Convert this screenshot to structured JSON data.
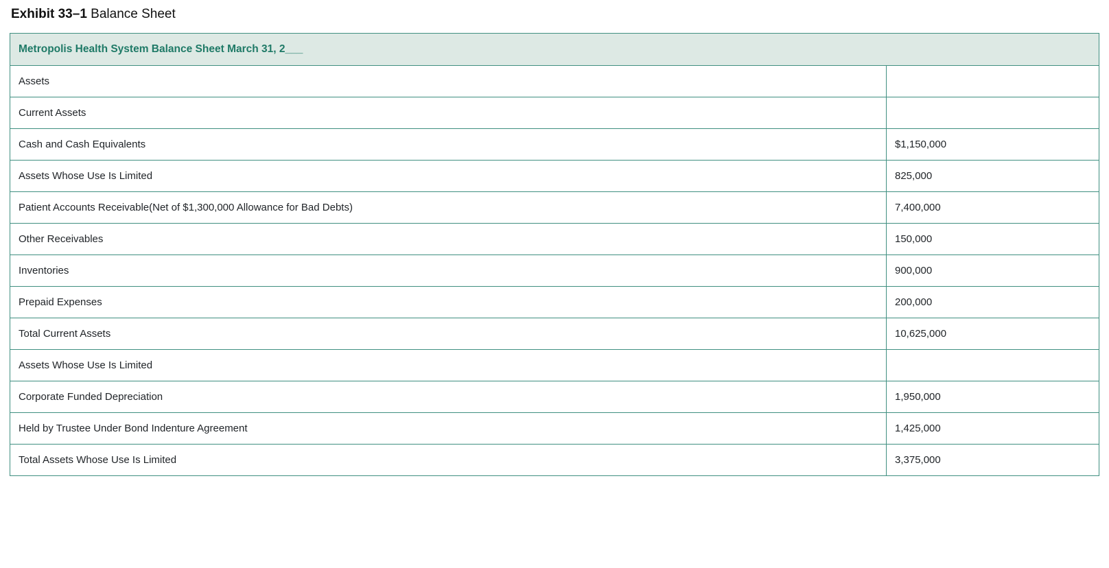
{
  "caption": {
    "bold": "Exhibit 33–1",
    "rest": "Balance Sheet"
  },
  "header": "Metropolis Health System Balance Sheet March 31, 2___",
  "rows": [
    {
      "label": "Assets",
      "value": ""
    },
    {
      "label": "Current Assets",
      "value": ""
    },
    {
      "label": "Cash and Cash Equivalents",
      "value": "$1,150,000"
    },
    {
      "label": "Assets Whose Use Is Limited",
      "value": "825,000"
    },
    {
      "label": "Patient Accounts Receivable(Net of $1,300,000 Allowance for Bad Debts)",
      "value": "7,400,000"
    },
    {
      "label": "Other Receivables",
      "value": "150,000"
    },
    {
      "label": "Inventories",
      "value": "900,000"
    },
    {
      "label": "Prepaid Expenses",
      "value": "200,000"
    },
    {
      "label": "Total Current Assets",
      "value": "10,625,000"
    },
    {
      "label": "Assets Whose Use Is Limited",
      "value": ""
    },
    {
      "label": "Corporate Funded Depreciation",
      "value": "1,950,000"
    },
    {
      "label": "Held by Trustee Under Bond Indenture Agreement",
      "value": "1,425,000"
    },
    {
      "label": "Total Assets Whose Use Is Limited",
      "value": "3,375,000"
    }
  ]
}
